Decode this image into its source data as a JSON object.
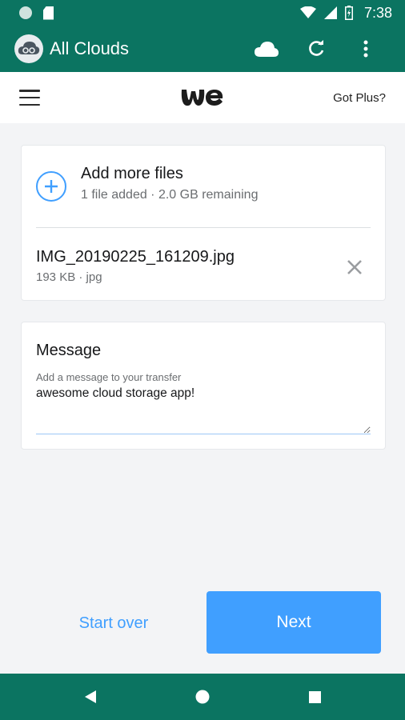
{
  "status_bar": {
    "time": "7:38",
    "icons": [
      "notification-dot-icon",
      "sd-card-icon",
      "wifi-icon",
      "signal-icon",
      "battery-icon"
    ]
  },
  "app_bar": {
    "title": "All Clouds",
    "actions": [
      "cloud-icon",
      "refresh-icon",
      "more-vert-icon"
    ],
    "color": "#0b7461"
  },
  "wetransfer_bar": {
    "brand": "we",
    "plus_link": "Got Plus?"
  },
  "files_card": {
    "add_title": "Add more files",
    "add_subtitle": "1 file added · 2.0 GB remaining",
    "files": [
      {
        "name": "IMG_20190225_161209.jpg",
        "meta": "193 KB · jpg"
      }
    ]
  },
  "message_card": {
    "title": "Message",
    "label": "Add a message to your transfer",
    "value": "awesome cloud storage app!"
  },
  "actions": {
    "start_over": "Start over",
    "next": "Next",
    "accent": "#409fff"
  },
  "nav_bar": {
    "buttons": [
      "back-icon",
      "home-icon",
      "recents-icon"
    ]
  }
}
